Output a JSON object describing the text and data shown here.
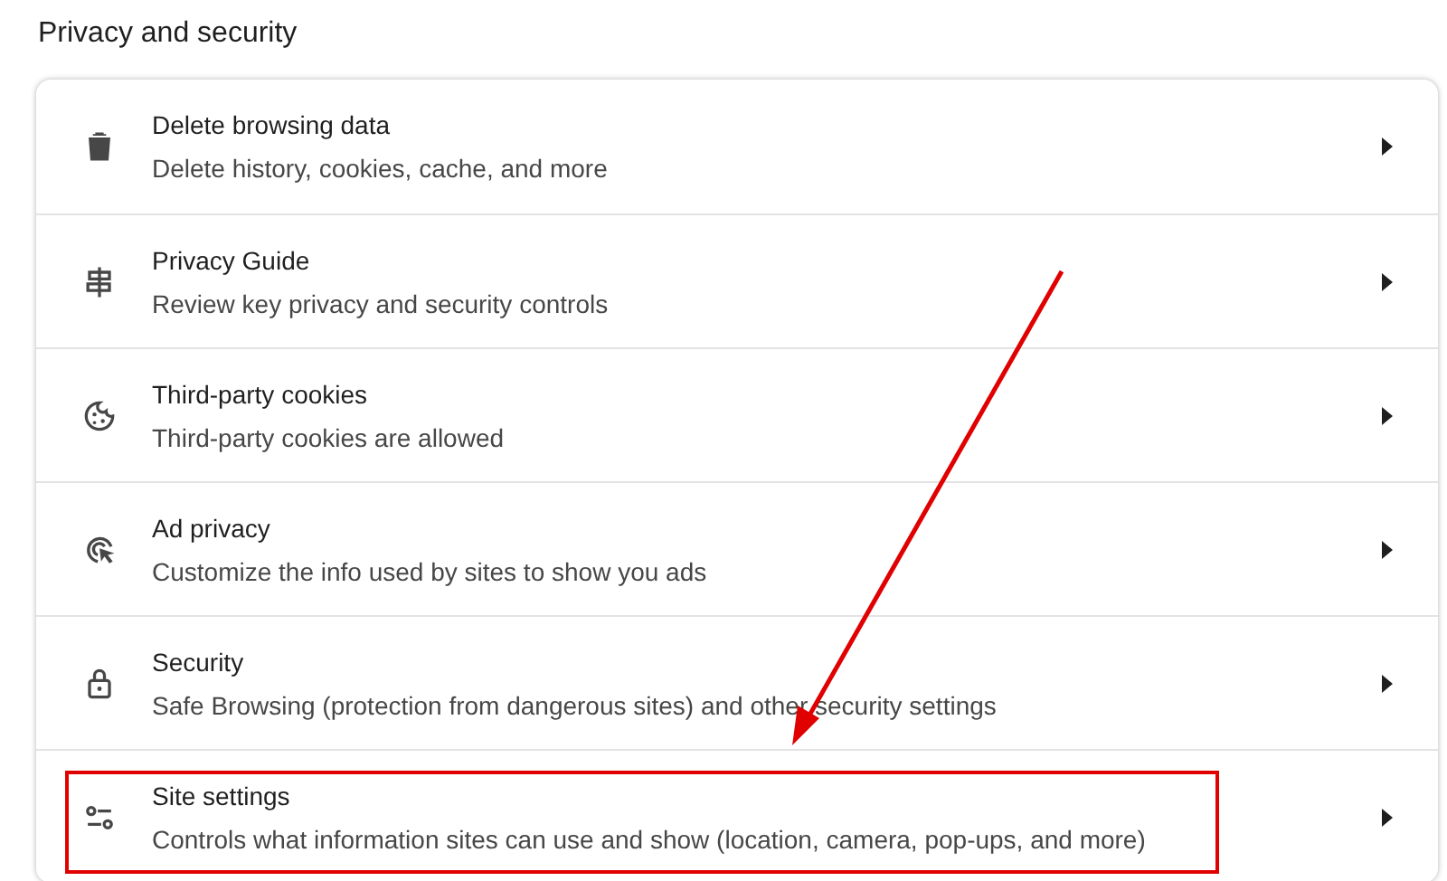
{
  "section_title": "Privacy and security",
  "rows": [
    {
      "title": "Delete browsing data",
      "subtitle": "Delete history, cookies, cache, and more",
      "highlighted": false
    },
    {
      "title": "Privacy Guide",
      "subtitle": "Review key privacy and security controls",
      "highlighted": false
    },
    {
      "title": "Third-party cookies",
      "subtitle": "Third-party cookies are allowed",
      "highlighted": false
    },
    {
      "title": "Ad privacy",
      "subtitle": "Customize the info used by sites to show you ads",
      "highlighted": false
    },
    {
      "title": "Security",
      "subtitle": "Safe Browsing (protection from dangerous sites) and other security settings",
      "highlighted": false
    },
    {
      "title": "Site settings",
      "subtitle": "Controls what information sites can use and show (location, camera, pop-ups, and more)",
      "highlighted": true
    }
  ]
}
